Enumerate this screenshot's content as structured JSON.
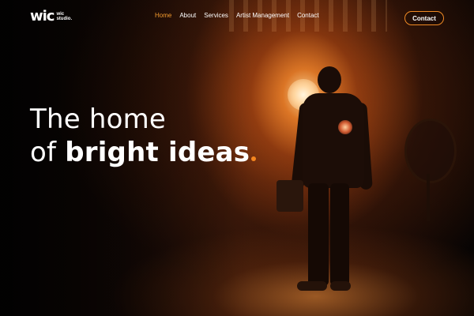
{
  "logo": {
    "mark": "wic",
    "text": "wic studio."
  },
  "nav": {
    "items": [
      {
        "label": "Home",
        "active": true
      },
      {
        "label": "About",
        "active": false
      },
      {
        "label": "Services",
        "active": false
      },
      {
        "label": "Artist Management",
        "active": false
      },
      {
        "label": "Contact",
        "active": false
      }
    ]
  },
  "contact_button": {
    "label": "Contact"
  },
  "hero": {
    "line1": "The home",
    "line2_prefix": "of ",
    "line2_bold": "bright ideas",
    "accent_color": "#f5861f"
  },
  "colors": {
    "nav_active": "#f39b2e",
    "button_border": "#f08a24"
  }
}
